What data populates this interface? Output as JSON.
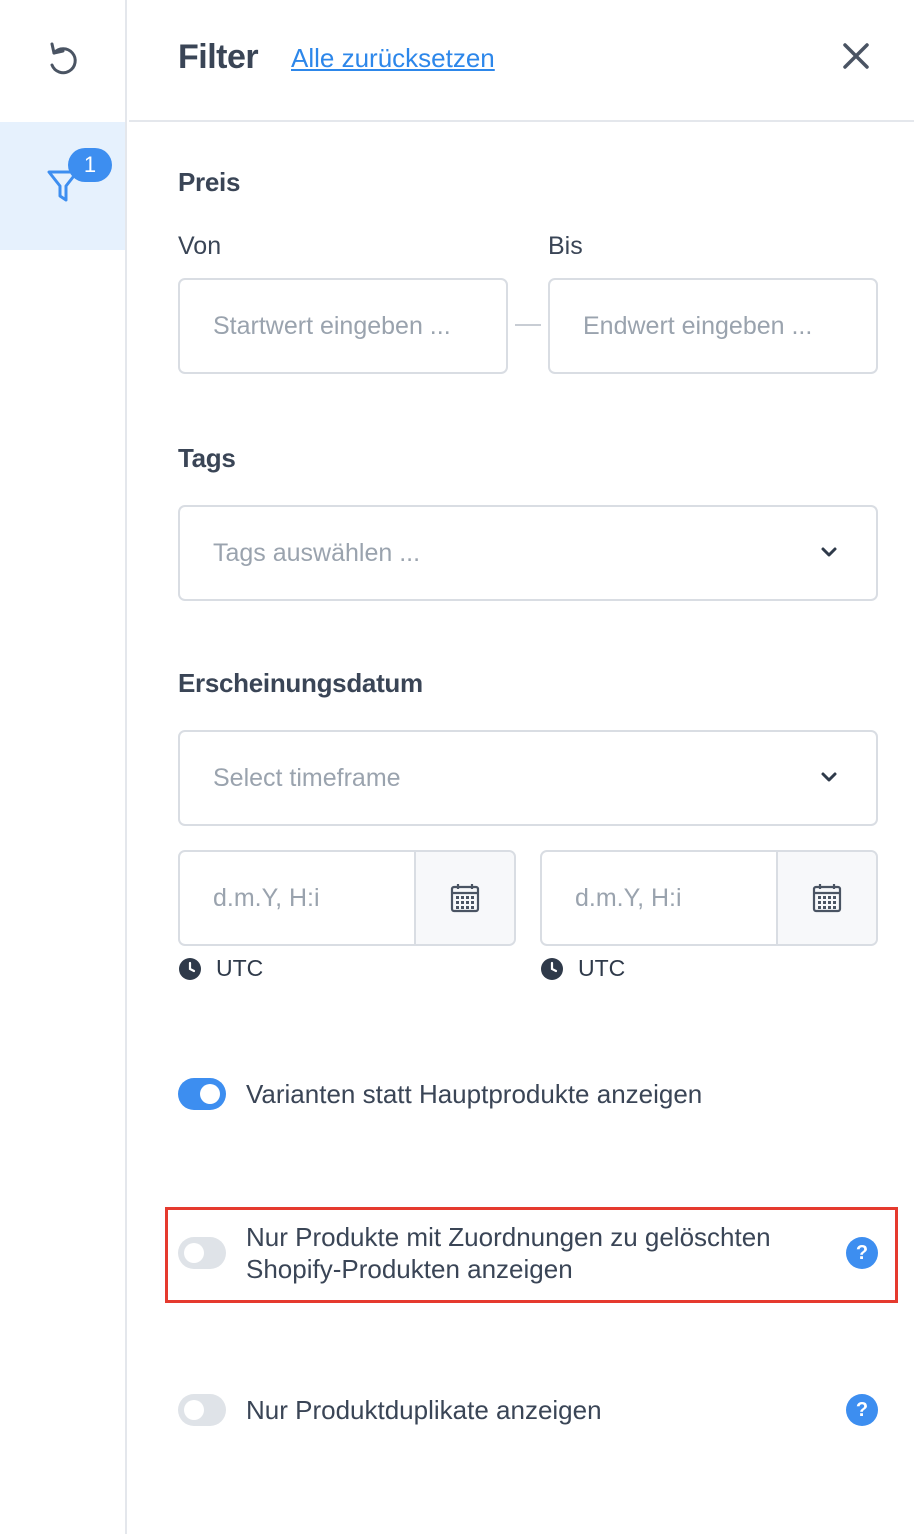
{
  "header": {
    "title": "Filter",
    "reset_label": "Alle zurücksetzen"
  },
  "rail": {
    "filter_badge": "1"
  },
  "price": {
    "section": "Preis",
    "from_label": "Von",
    "to_label": "Bis",
    "from_placeholder": "Startwert eingeben ...",
    "to_placeholder": "Endwert eingeben ..."
  },
  "tags": {
    "section": "Tags",
    "placeholder": "Tags auswählen ..."
  },
  "release_date": {
    "section": "Erscheinungsdatum",
    "timeframe_placeholder": "Select timeframe",
    "start_placeholder": "d.m.Y, H:i",
    "end_placeholder": "d.m.Y, H:i",
    "start_timezone": "UTC",
    "end_timezone": "UTC"
  },
  "toggles": [
    {
      "label": "Varianten statt Hauptprodukte anzeigen",
      "on": true
    },
    {
      "label_line1": "Nur Produkte mit Zuordnungen zu gelöschten",
      "label_line2": "Shopify-Produkten anzeigen",
      "on": false
    },
    {
      "label": "Nur Produktduplikate anzeigen",
      "on": false
    }
  ],
  "help_glyph": "?",
  "colors": {
    "accent": "#3d8ef0",
    "link": "#2d87ea",
    "highlight": "#e53a2e",
    "active_rail": "#e6f1fd"
  }
}
